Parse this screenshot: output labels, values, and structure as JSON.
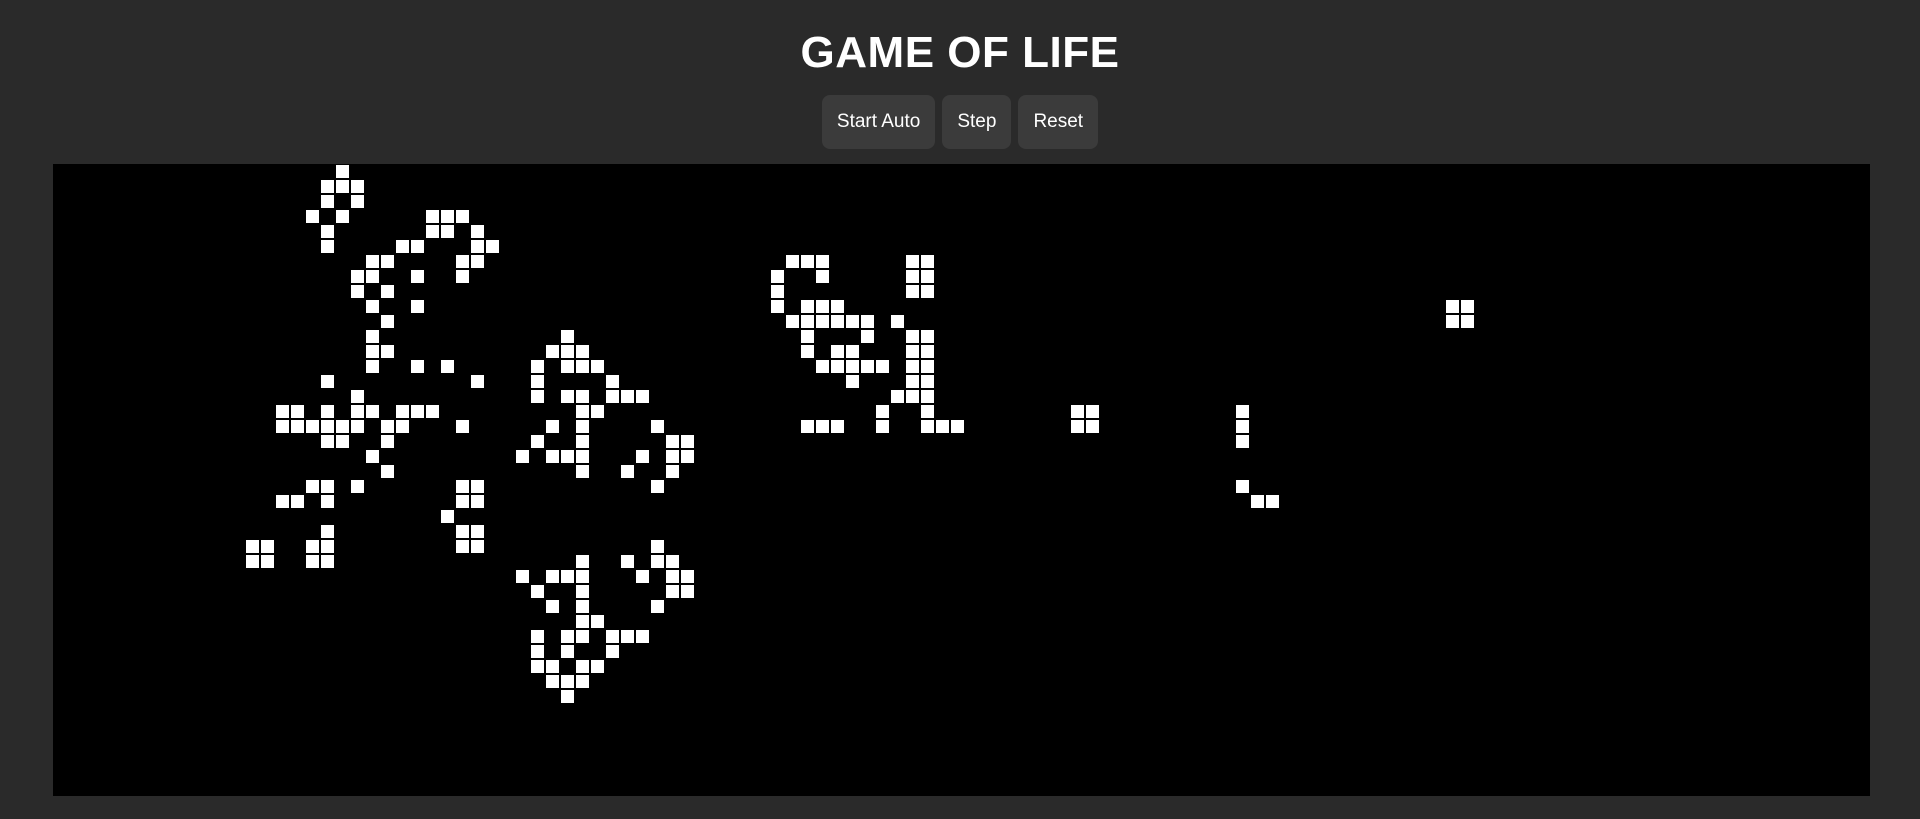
{
  "app": {
    "title": "GAME OF LIFE"
  },
  "controls": {
    "start_label": "Start Auto",
    "step_label": "Step",
    "reset_label": "Reset"
  },
  "colors": {
    "background": "#2a2a2a",
    "board": "#000000",
    "live_cell": "#ffffff",
    "button": "#3b3b3b"
  },
  "board": {
    "live_cells": [
      [
        0,
        19
      ],
      [
        1,
        18
      ],
      [
        1,
        19
      ],
      [
        1,
        20
      ],
      [
        2,
        18
      ],
      [
        2,
        20
      ],
      [
        3,
        17
      ],
      [
        3,
        19
      ],
      [
        3,
        25
      ],
      [
        3,
        26
      ],
      [
        3,
        27
      ],
      [
        4,
        18
      ],
      [
        4,
        25
      ],
      [
        4,
        26
      ],
      [
        4,
        28
      ],
      [
        5,
        18
      ],
      [
        5,
        23
      ],
      [
        5,
        24
      ],
      [
        5,
        28
      ],
      [
        5,
        29
      ],
      [
        6,
        21
      ],
      [
        6,
        22
      ],
      [
        6,
        27
      ],
      [
        6,
        28
      ],
      [
        6,
        49
      ],
      [
        6,
        50
      ],
      [
        6,
        51
      ],
      [
        6,
        57
      ],
      [
        6,
        58
      ],
      [
        7,
        20
      ],
      [
        7,
        21
      ],
      [
        7,
        24
      ],
      [
        7,
        27
      ],
      [
        7,
        48
      ],
      [
        7,
        51
      ],
      [
        7,
        57
      ],
      [
        7,
        58
      ],
      [
        8,
        20
      ],
      [
        8,
        22
      ],
      [
        8,
        48
      ],
      [
        8,
        57
      ],
      [
        8,
        58
      ],
      [
        9,
        21
      ],
      [
        9,
        24
      ],
      [
        9,
        48
      ],
      [
        9,
        50
      ],
      [
        9,
        51
      ],
      [
        9,
        52
      ],
      [
        9,
        93
      ],
      [
        9,
        94
      ],
      [
        10,
        22
      ],
      [
        10,
        49
      ],
      [
        10,
        50
      ],
      [
        10,
        51
      ],
      [
        10,
        52
      ],
      [
        10,
        53
      ],
      [
        10,
        54
      ],
      [
        10,
        56
      ],
      [
        10,
        93
      ],
      [
        10,
        94
      ],
      [
        11,
        21
      ],
      [
        11,
        34
      ],
      [
        11,
        50
      ],
      [
        11,
        54
      ],
      [
        11,
        57
      ],
      [
        11,
        58
      ],
      [
        12,
        21
      ],
      [
        12,
        22
      ],
      [
        12,
        33
      ],
      [
        12,
        34
      ],
      [
        12,
        35
      ],
      [
        12,
        50
      ],
      [
        12,
        52
      ],
      [
        12,
        53
      ],
      [
        12,
        57
      ],
      [
        12,
        58
      ],
      [
        13,
        21
      ],
      [
        13,
        24
      ],
      [
        13,
        26
      ],
      [
        13,
        32
      ],
      [
        13,
        34
      ],
      [
        13,
        35
      ],
      [
        13,
        36
      ],
      [
        13,
        51
      ],
      [
        13,
        52
      ],
      [
        13,
        53
      ],
      [
        13,
        54
      ],
      [
        13,
        55
      ],
      [
        13,
        57
      ],
      [
        13,
        58
      ],
      [
        14,
        18
      ],
      [
        14,
        28
      ],
      [
        14,
        32
      ],
      [
        14,
        37
      ],
      [
        14,
        53
      ],
      [
        14,
        57
      ],
      [
        14,
        58
      ],
      [
        15,
        20
      ],
      [
        15,
        32
      ],
      [
        15,
        34
      ],
      [
        15,
        35
      ],
      [
        15,
        37
      ],
      [
        15,
        38
      ],
      [
        15,
        39
      ],
      [
        15,
        56
      ],
      [
        15,
        57
      ],
      [
        15,
        58
      ],
      [
        16,
        15
      ],
      [
        16,
        16
      ],
      [
        16,
        18
      ],
      [
        16,
        20
      ],
      [
        16,
        21
      ],
      [
        16,
        23
      ],
      [
        16,
        24
      ],
      [
        16,
        25
      ],
      [
        16,
        35
      ],
      [
        16,
        36
      ],
      [
        16,
        55
      ],
      [
        16,
        58
      ],
      [
        16,
        68
      ],
      [
        16,
        69
      ],
      [
        16,
        79
      ],
      [
        17,
        15
      ],
      [
        17,
        16
      ],
      [
        17,
        17
      ],
      [
        17,
        18
      ],
      [
        17,
        19
      ],
      [
        17,
        20
      ],
      [
        17,
        22
      ],
      [
        17,
        23
      ],
      [
        17,
        27
      ],
      [
        17,
        33
      ],
      [
        17,
        35
      ],
      [
        17,
        40
      ],
      [
        17,
        50
      ],
      [
        17,
        51
      ],
      [
        17,
        52
      ],
      [
        17,
        55
      ],
      [
        17,
        58
      ],
      [
        17,
        59
      ],
      [
        17,
        60
      ],
      [
        17,
        68
      ],
      [
        17,
        69
      ],
      [
        17,
        79
      ],
      [
        18,
        18
      ],
      [
        18,
        19
      ],
      [
        18,
        22
      ],
      [
        18,
        32
      ],
      [
        18,
        35
      ],
      [
        18,
        41
      ],
      [
        18,
        42
      ],
      [
        18,
        79
      ],
      [
        19,
        21
      ],
      [
        19,
        31
      ],
      [
        19,
        33
      ],
      [
        19,
        34
      ],
      [
        19,
        35
      ],
      [
        19,
        39
      ],
      [
        19,
        41
      ],
      [
        19,
        42
      ],
      [
        20,
        22
      ],
      [
        20,
        35
      ],
      [
        20,
        38
      ],
      [
        20,
        41
      ],
      [
        21,
        17
      ],
      [
        21,
        18
      ],
      [
        21,
        20
      ],
      [
        21,
        27
      ],
      [
        21,
        28
      ],
      [
        21,
        40
      ],
      [
        21,
        79
      ],
      [
        22,
        15
      ],
      [
        22,
        16
      ],
      [
        22,
        18
      ],
      [
        22,
        27
      ],
      [
        22,
        28
      ],
      [
        22,
        80
      ],
      [
        22,
        81
      ],
      [
        23,
        26
      ],
      [
        24,
        18
      ],
      [
        24,
        27
      ],
      [
        24,
        28
      ],
      [
        25,
        13
      ],
      [
        25,
        14
      ],
      [
        25,
        17
      ],
      [
        25,
        18
      ],
      [
        25,
        27
      ],
      [
        25,
        28
      ],
      [
        25,
        40
      ],
      [
        26,
        13
      ],
      [
        26,
        14
      ],
      [
        26,
        17
      ],
      [
        26,
        18
      ],
      [
        26,
        35
      ],
      [
        26,
        38
      ],
      [
        26,
        40
      ],
      [
        26,
        41
      ],
      [
        27,
        31
      ],
      [
        27,
        33
      ],
      [
        27,
        34
      ],
      [
        27,
        35
      ],
      [
        27,
        39
      ],
      [
        27,
        41
      ],
      [
        27,
        42
      ],
      [
        28,
        32
      ],
      [
        28,
        35
      ],
      [
        28,
        41
      ],
      [
        28,
        42
      ],
      [
        29,
        33
      ],
      [
        29,
        35
      ],
      [
        29,
        40
      ],
      [
        30,
        35
      ],
      [
        30,
        36
      ],
      [
        31,
        32
      ],
      [
        31,
        34
      ],
      [
        31,
        35
      ],
      [
        31,
        37
      ],
      [
        31,
        38
      ],
      [
        31,
        39
      ],
      [
        32,
        32
      ],
      [
        32,
        34
      ],
      [
        32,
        37
      ],
      [
        33,
        32
      ],
      [
        33,
        33
      ],
      [
        33,
        35
      ],
      [
        33,
        36
      ],
      [
        34,
        33
      ],
      [
        34,
        34
      ],
      [
        34,
        35
      ],
      [
        35,
        34
      ]
    ]
  }
}
